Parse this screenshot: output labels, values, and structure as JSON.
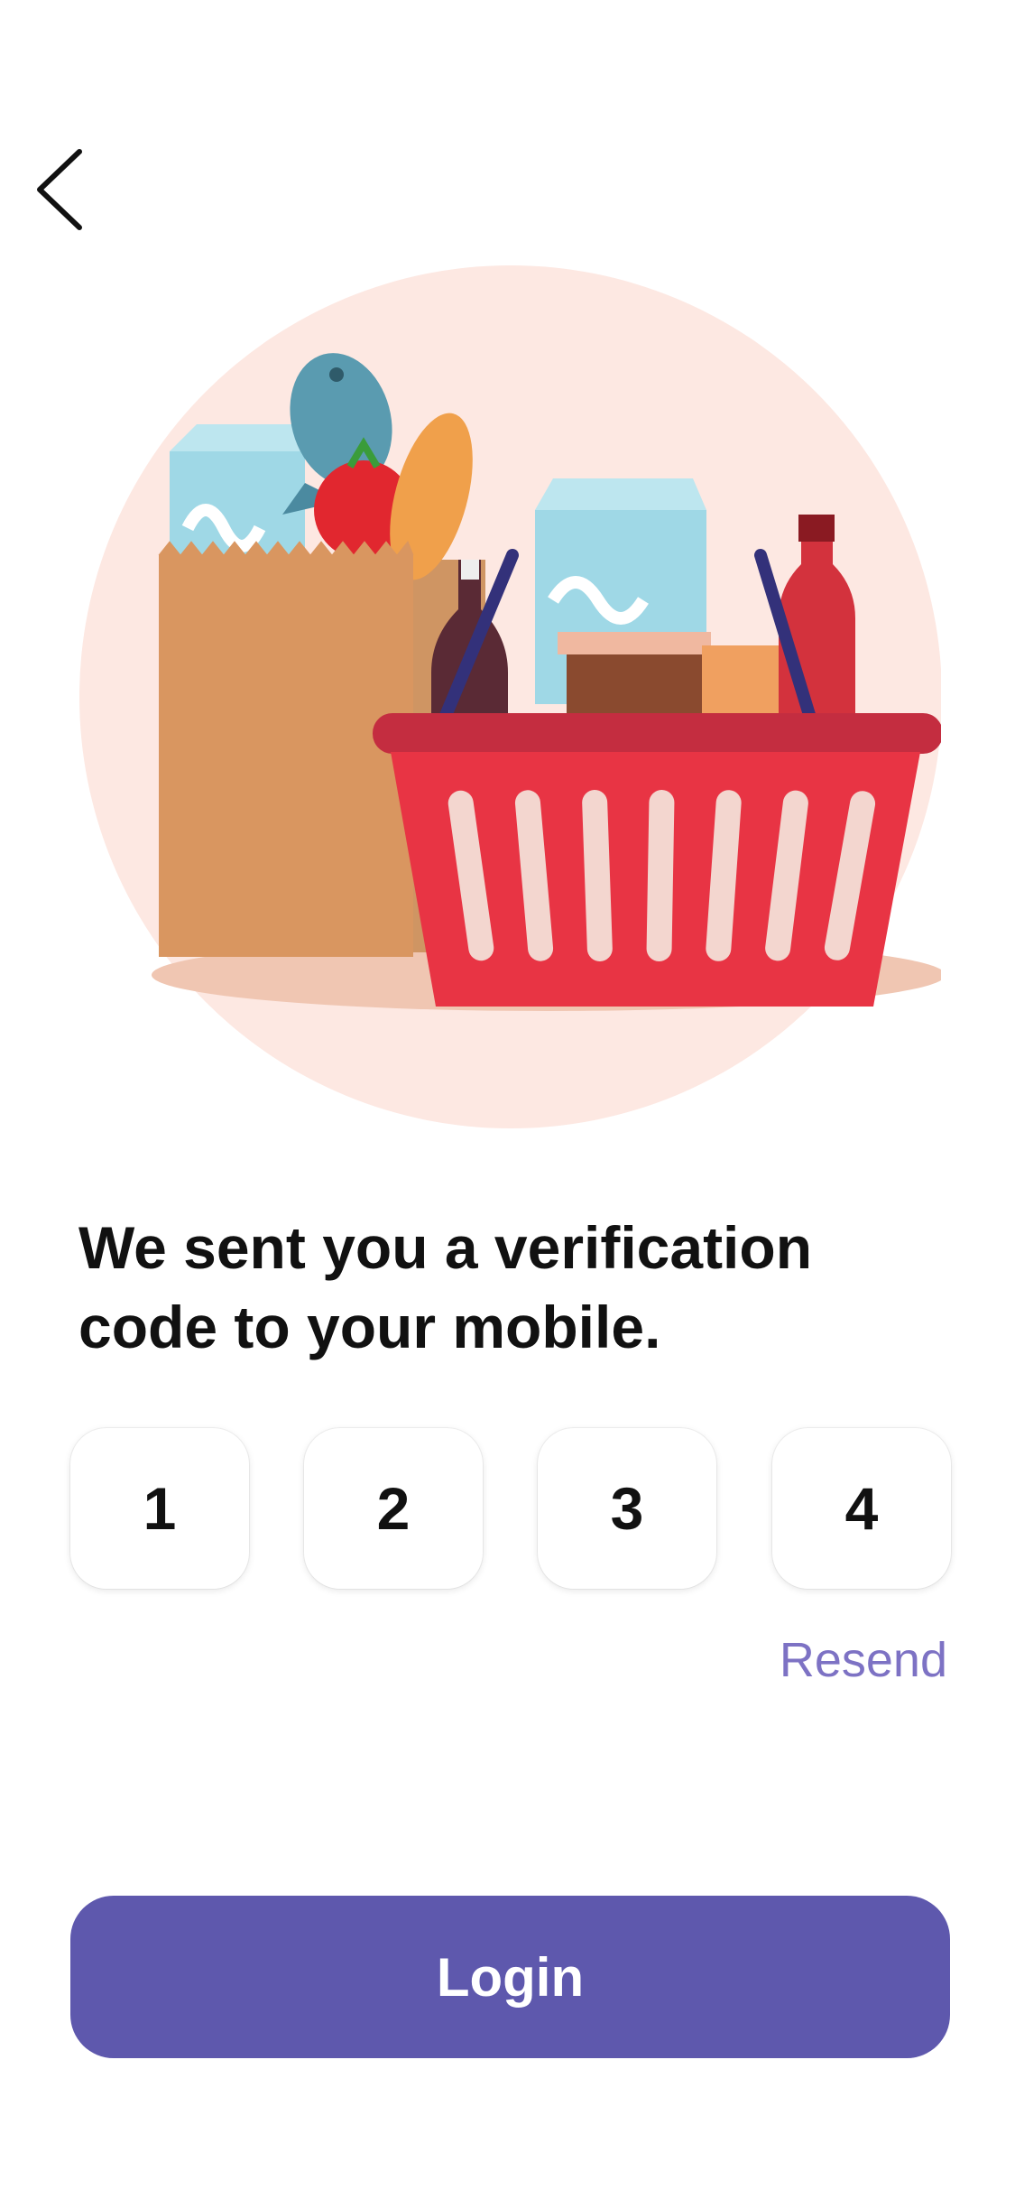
{
  "nav": {
    "back_icon": "chevron-left-icon"
  },
  "illustration": {
    "subject": "grocery-basket-illustration"
  },
  "headline": {
    "line1": "We sent you a verification",
    "line2": "code to your mobile."
  },
  "code": {
    "digits": [
      "1",
      "2",
      "3",
      "4"
    ]
  },
  "resend": {
    "label": "Resend"
  },
  "login": {
    "label": "Login"
  },
  "colors": {
    "accent": "#5e58ad",
    "link": "#7d72c4",
    "illustration_bg": "#fde8e2"
  }
}
